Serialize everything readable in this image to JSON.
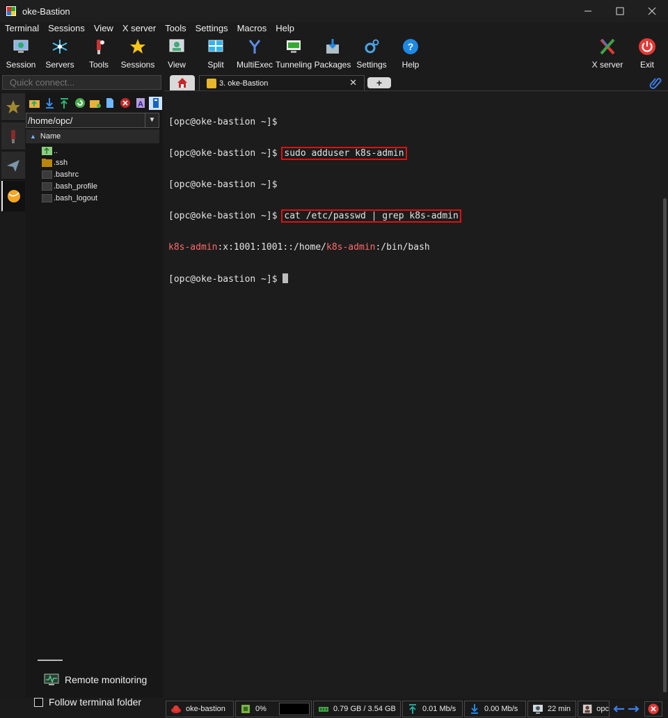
{
  "window": {
    "title": "oke-Bastion"
  },
  "menu": [
    "Terminal",
    "Sessions",
    "View",
    "X server",
    "Tools",
    "Settings",
    "Macros",
    "Help"
  ],
  "toolbar": {
    "session": "Session",
    "servers": "Servers",
    "tools": "Tools",
    "sessions": "Sessions",
    "view": "View",
    "split": "Split",
    "multiexec": "MultiExec",
    "tunneling": "Tunneling",
    "packages": "Packages",
    "settings": "Settings",
    "help": "Help",
    "xserver": "X server",
    "exit": "Exit"
  },
  "sidebar": {
    "quick_connect_placeholder": "Quick connect...",
    "path": "/home/opc/",
    "column_name": "Name",
    "files": [
      "..",
      ".ssh",
      ".bashrc",
      ".bash_profile",
      ".bash_logout"
    ],
    "remote_monitoring": "Remote monitoring",
    "follow_folder": "Follow terminal folder"
  },
  "tabs": {
    "session_tab": "3. oke-Bastion",
    "close": "✕",
    "new": "+"
  },
  "terminal": {
    "prompt": "[opc@oke-bastion ~]$",
    "cmd1": "sudo adduser k8s-admin",
    "cmd2": "cat /etc/passwd | grep k8s-admin",
    "out_user": "k8s-admin",
    "out_mid": ":x:1001:1001::/home/",
    "out_end": ":/bin/bash"
  },
  "status": {
    "host": "oke-bastion",
    "cpu": "0%",
    "memory": "0.79 GB / 3.54 GB",
    "upload": "0.01 Mb/s",
    "download": "0.00 Mb/s",
    "uptime": "22 min",
    "user": "opc"
  },
  "colors": {
    "highlight_box": "#dd1111",
    "grep_match": "#ff6a6a"
  }
}
